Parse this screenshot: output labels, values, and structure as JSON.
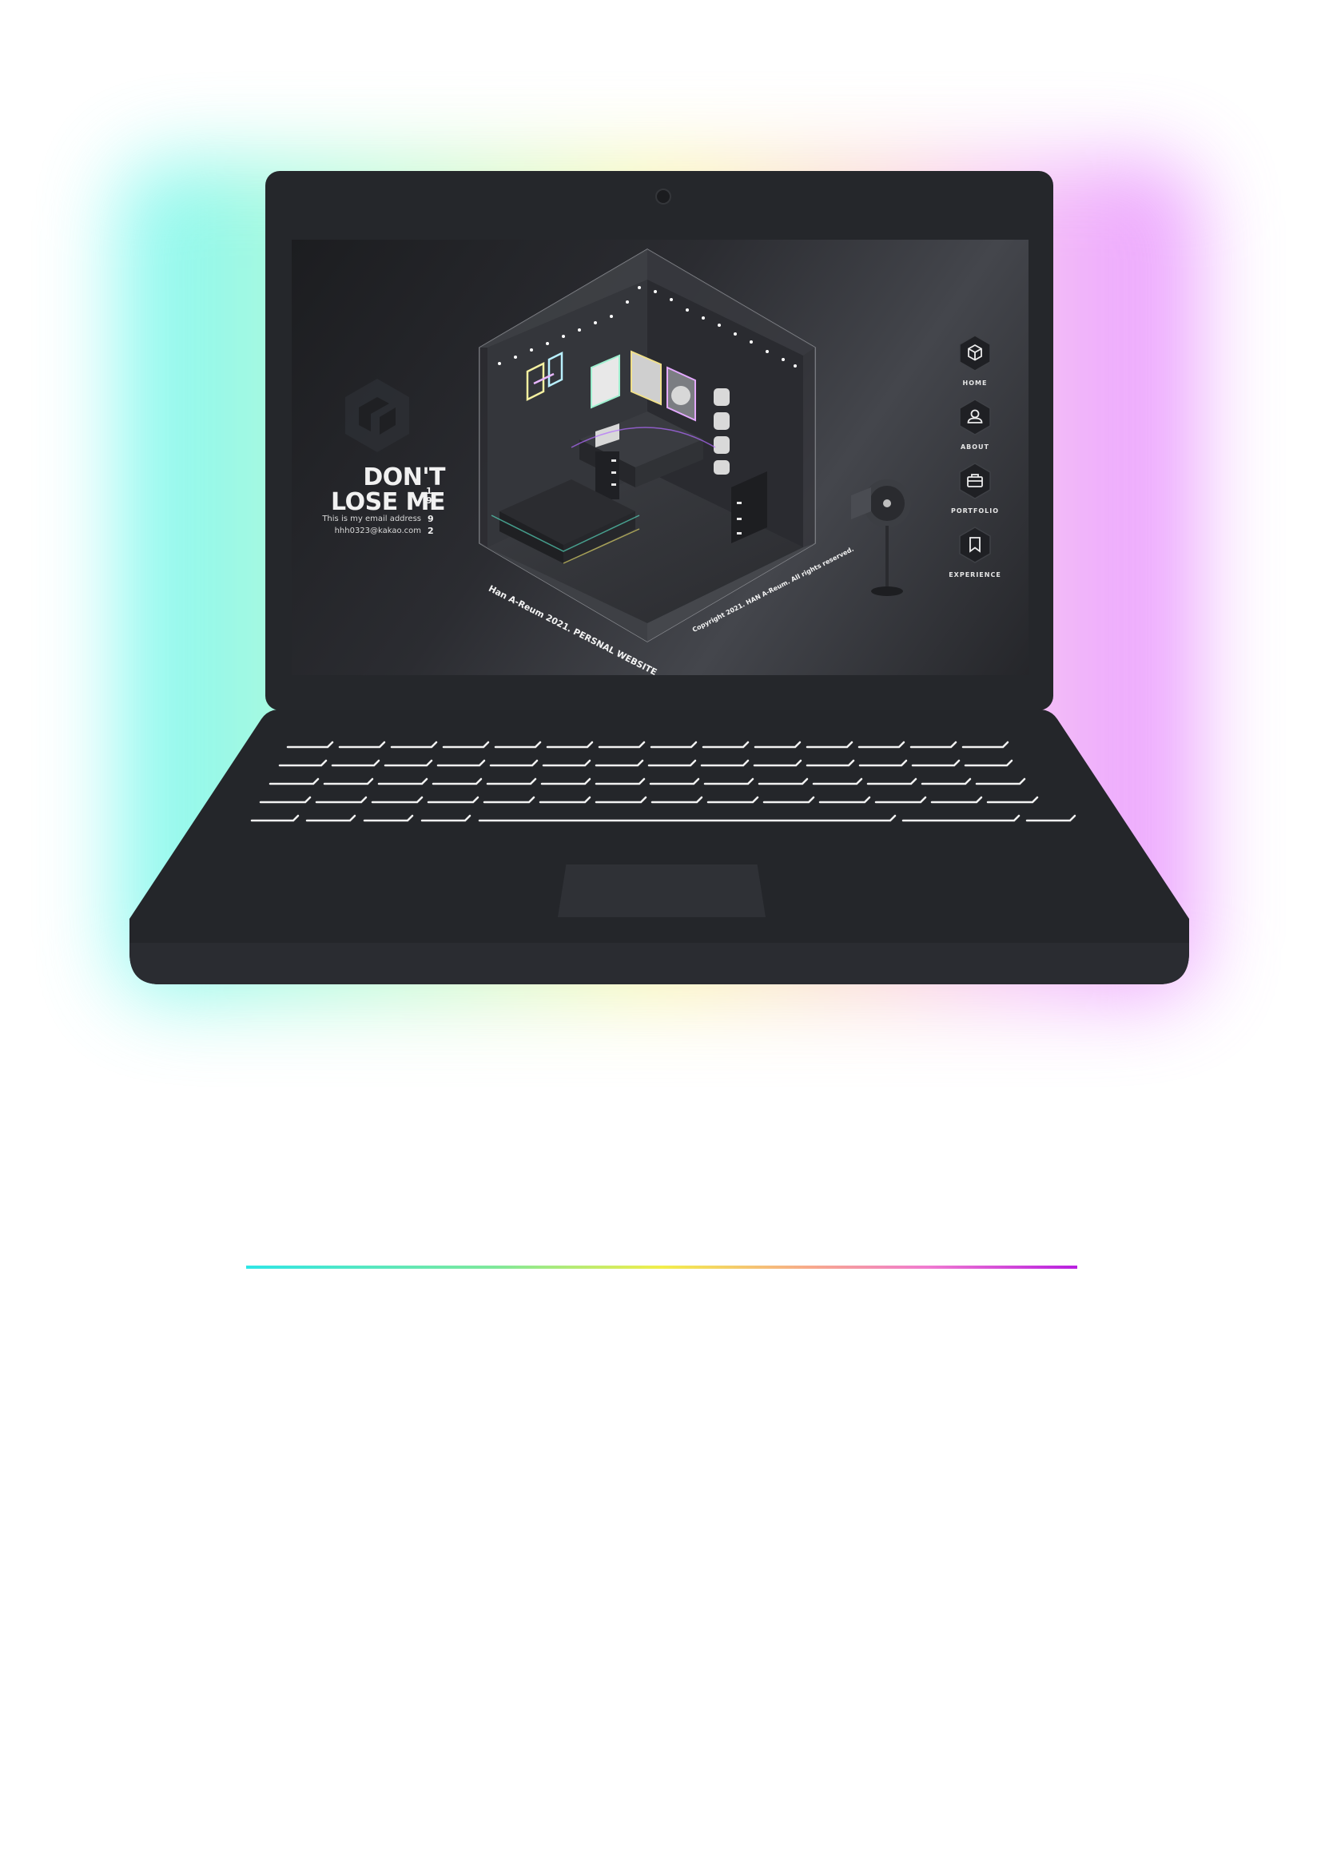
{
  "screen": {
    "headline": {
      "line1": "DON'T",
      "line2": "LOSE ME"
    },
    "year_digits": [
      "1",
      "9",
      "9",
      "2"
    ],
    "email_caption": "This is my email address",
    "email_address": "hhh0323@kakao.com",
    "room_caption_left": "Han A-Reum 2021. PERSNAL WEBSITE",
    "room_caption_right": "Copyright 2021. HAN A-Reum. All rights reserved.",
    "nav": [
      {
        "label": "HOME",
        "icon": "cube-icon"
      },
      {
        "label": "ABOUT",
        "icon": "user-icon"
      },
      {
        "label": "PORTFOLIO",
        "icon": "briefcase-icon"
      },
      {
        "label": "EXPERIENCE",
        "icon": "bookmark-icon"
      }
    ]
  },
  "colors": {
    "laptop_body": "#25272b",
    "glow_start": "#5ff6ef",
    "glow_end": "#e27dff"
  }
}
